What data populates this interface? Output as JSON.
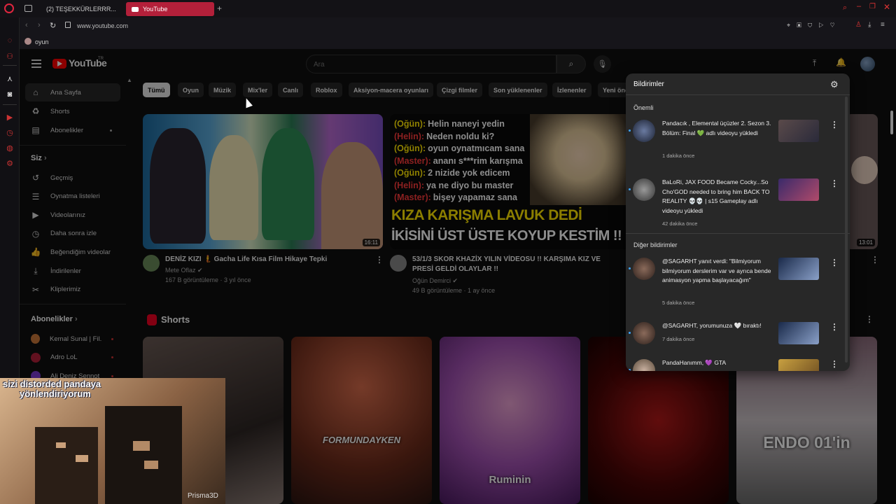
{
  "browser": {
    "tabs": [
      {
        "label": "(2) TEŞEKKÜRLERRR..."
      },
      {
        "label": "YouTube"
      }
    ],
    "url": "www.youtube.com",
    "bookmark": "oyun"
  },
  "youtube": {
    "logo_text": "YouTube",
    "logo_sup": "TR",
    "search_placeholder": "Ara",
    "nav": [
      {
        "label": "Ana Sayfa",
        "icon": "home-icon",
        "glyph": "⌂"
      },
      {
        "label": "Shorts",
        "icon": "shorts-icon",
        "glyph": "♻"
      },
      {
        "label": "Abonelikler",
        "icon": "subscriptions-icon",
        "glyph": "▤"
      }
    ],
    "you_section": "Siz",
    "you_items": [
      {
        "label": "Geçmiş",
        "icon": "history-icon",
        "glyph": "↺"
      },
      {
        "label": "Oynatma listeleri",
        "icon": "playlists-icon",
        "glyph": "☰"
      },
      {
        "label": "Videolarınız",
        "icon": "your-videos-icon",
        "glyph": "▶"
      },
      {
        "label": "Daha sonra izle",
        "icon": "watch-later-icon",
        "glyph": "◷"
      },
      {
        "label": "Beğendiğim videolar",
        "icon": "liked-icon",
        "glyph": "👍"
      },
      {
        "label": "İndirilenler",
        "icon": "downloads-icon",
        "glyph": "⤓"
      },
      {
        "label": "Kliplerimiz",
        "icon": "clips-icon",
        "glyph": "✂"
      }
    ],
    "subs_section": "Abonelikler",
    "subs": [
      {
        "label": "Kemal Sunal | Fil...",
        "color": "#c9773a"
      },
      {
        "label": "Adro LoL",
        "color": "#b1203a"
      },
      {
        "label": "Ali Deniz Sennot",
        "color": "#7a3ad0"
      }
    ],
    "chips": [
      "Tümü",
      "Oyun",
      "Müzik",
      "Mix'ler",
      "Canlı",
      "Roblox",
      "Aksiyon-macera oyunları",
      "Çizgi filmler",
      "Son yüklenenler",
      "İzlenenler",
      "Yeni öne"
    ],
    "videos": [
      {
        "title": "DENİZ KIZI 🧜 Gacha Life Kısa Film Hikaye Tepki",
        "channel": "Mete Oflaz",
        "meta": "167 B görüntüleme · 3 yıl önce",
        "duration": "16:11"
      },
      {
        "title": "53/1/3 SKOR KHAZİX YILIN VİDEOSU !! KARŞIMA KIZ VE PRESİ GELDİ OLAYLAR !!",
        "channel": "Oğün Demirci",
        "meta": "49 B görüntüleme · 1 ay önce",
        "thumb_lines": [
          {
            "who": "(Oğün):",
            "text": "Helin naneyi yedin",
            "c": "#ffe600"
          },
          {
            "who": "(Helin):",
            "text": "Neden noldu ki?",
            "c": "#ff3b3b"
          },
          {
            "who": "(Oğün):",
            "text": "oyun oynatmıcam sana",
            "c": "#ffe600"
          },
          {
            "who": "(Master):",
            "text": "ananı s***rim karışma",
            "c": "#ff3b3b"
          },
          {
            "who": "(Oğün):",
            "text": "2 nizide yok edicem",
            "c": "#ffe600"
          },
          {
            "who": "(Helin):",
            "text": "ya ne diyo bu master",
            "c": "#ff3b3b"
          },
          {
            "who": "(Master):",
            "text": "bişey yapamaz sana",
            "c": "#ff3b3b"
          }
        ],
        "thumb_big1": "KIZA KARIŞMA LAVUK DEDİ",
        "thumb_big2": "İKİSİNİ ÜST ÜSTE KOYUP KESTİM !!"
      },
      {
        "duration": "13:01"
      }
    ],
    "shorts_title": "Shorts",
    "shorts": [
      {
        "caption": ""
      },
      {
        "caption": "FORMUNDAYKEN"
      },
      {
        "caption": "Ruminin"
      },
      {
        "caption": ""
      },
      {
        "caption": "ENDO 01'in"
      }
    ],
    "notifications": {
      "title": "Bildirimler",
      "important_label": "Önemli",
      "other_label": "Diğer bildirimler",
      "items": [
        {
          "text": "Pandacık , Elemental üçüzler 2. Sezon 3. Bölüm: Final 💚 adlı videoyu yükledi",
          "time": "1 dakika önce"
        },
        {
          "text": "BaLoRi, JAX FOOD Became Cocky...So Cho'GOD needed to bring him BACK TO REALITY 💀💀 | s15 Gameplay adlı videoyu yükledi",
          "time": "42 dakika önce"
        },
        {
          "text": "@SAGARHT yanıt verdi: \"Bilmiyorum bilmiyorum derslerim var ve ayrıca bende animasyon yapma başlayacağım\"",
          "time": "5 dakika önce"
        },
        {
          "text": "@SAGARHT, yorumunuza 🤍 bıraktı!",
          "time": "7 dakika önce"
        },
        {
          "text": "PandaHanımm, 💜 GTA",
          "time": ""
        }
      ]
    }
  },
  "overlay": {
    "caption_line1": "sizi distorded pandaya",
    "caption_line2": "yönlendiriyorum",
    "watermark": "Prisma3D"
  }
}
